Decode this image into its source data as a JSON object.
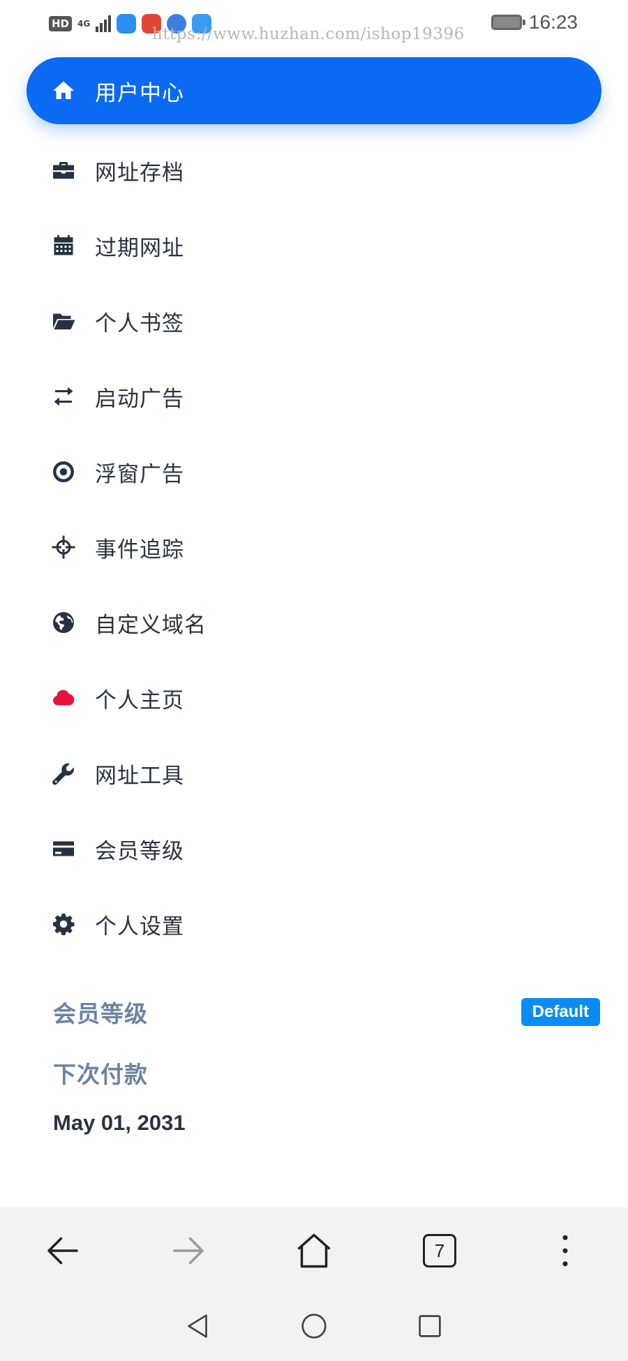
{
  "status_bar": {
    "network_hd": "HD",
    "network_type": "4G",
    "watermark_url": "https://www.huzhan.com/ishop19396",
    "time": "16:23"
  },
  "menu": {
    "items": [
      {
        "label": "用户中心",
        "icon": "home-icon",
        "active": true
      },
      {
        "label": "网址存档",
        "icon": "briefcase-icon"
      },
      {
        "label": "过期网址",
        "icon": "calendar-icon"
      },
      {
        "label": "个人书签",
        "icon": "folder-open-icon"
      },
      {
        "label": "启动广告",
        "icon": "exchange-icon"
      },
      {
        "label": "浮窗广告",
        "icon": "target-icon"
      },
      {
        "label": "事件追踪",
        "icon": "crosshairs-icon"
      },
      {
        "label": "自定义域名",
        "icon": "globe-icon"
      },
      {
        "label": "个人主页",
        "icon": "cloud-icon"
      },
      {
        "label": "网址工具",
        "icon": "wrench-icon"
      },
      {
        "label": "会员等级",
        "icon": "credit-card-icon"
      },
      {
        "label": "个人设置",
        "icon": "gear-icon"
      }
    ]
  },
  "membership": {
    "level_label": "会员等级",
    "level_badge": "Default",
    "next_payment_label": "下次付款",
    "next_payment_date": "May 01, 2031"
  },
  "browser_toolbar": {
    "tab_count": "7"
  },
  "colors": {
    "accent": "#0a6af2",
    "badge": "#0a8cf2",
    "cloud_icon": "#e8113a",
    "label_muted": "#6c83a2",
    "text": "#2a3340"
  }
}
